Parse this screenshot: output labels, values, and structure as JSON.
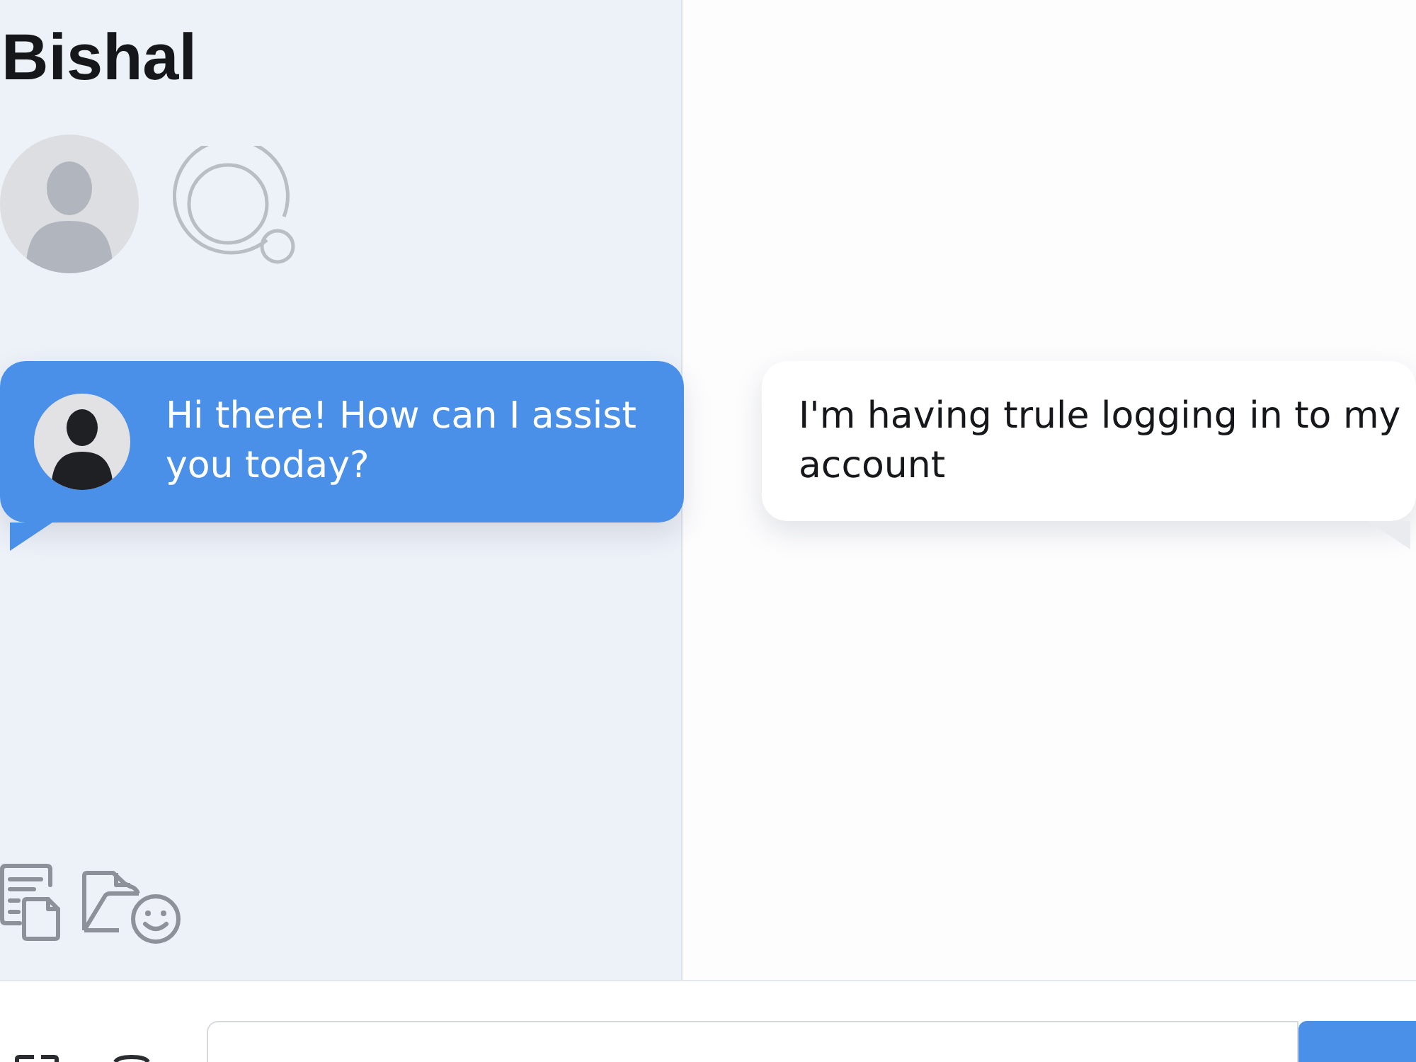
{
  "header": {
    "title": "Bishal"
  },
  "messages": [
    {
      "kind": "received",
      "text": "Hi there! How can I assist you today?"
    },
    {
      "kind": "sent",
      "text": "I'm having trule logging in to my account"
    }
  ]
}
